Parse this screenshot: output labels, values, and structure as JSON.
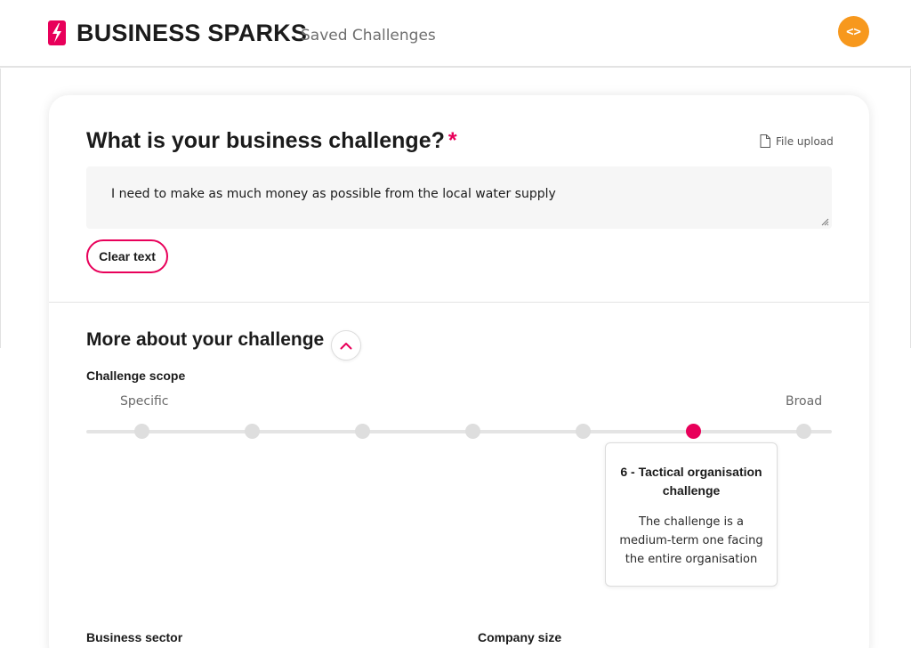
{
  "header": {
    "brand": "BUSINESS SPARKS",
    "nav_saved": "Saved Challenges",
    "action_icon_text": "<>",
    "accent_color": "#e8005a",
    "action_color": "#f7981d"
  },
  "challenge": {
    "title": "What is your business challenge?",
    "required_marker": "*",
    "file_upload_label": "File upload",
    "text_value": "I need to make as much money as possible from the local water supply",
    "clear_button": "Clear text"
  },
  "more": {
    "title": "More about your challenge",
    "scope_label": "Challenge scope",
    "scope_min_label": "Specific",
    "scope_max_label": "Broad",
    "scope_steps": 7,
    "scope_value": 6,
    "tooltip_title": "6 - Tactical organisation challenge",
    "tooltip_description": "The challenge is a medium-term one facing the entire organisation"
  },
  "fields": {
    "business_sector_label": "Business sector",
    "company_size_label": "Company size"
  }
}
